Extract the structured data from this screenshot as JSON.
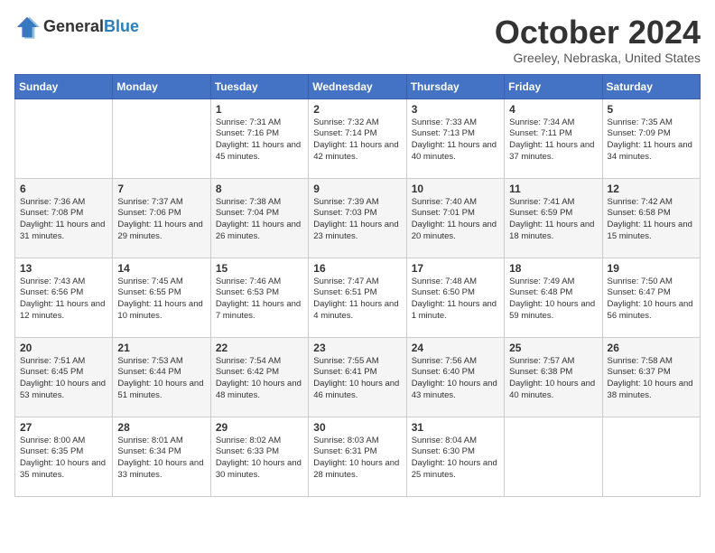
{
  "header": {
    "logo_general": "General",
    "logo_blue": "Blue",
    "month_title": "October 2024",
    "location": "Greeley, Nebraska, United States"
  },
  "days_of_week": [
    "Sunday",
    "Monday",
    "Tuesday",
    "Wednesday",
    "Thursday",
    "Friday",
    "Saturday"
  ],
  "weeks": [
    [
      {
        "day": "",
        "sunrise": "",
        "sunset": "",
        "daylight": ""
      },
      {
        "day": "",
        "sunrise": "",
        "sunset": "",
        "daylight": ""
      },
      {
        "day": "1",
        "sunrise": "Sunrise: 7:31 AM",
        "sunset": "Sunset: 7:16 PM",
        "daylight": "Daylight: 11 hours and 45 minutes."
      },
      {
        "day": "2",
        "sunrise": "Sunrise: 7:32 AM",
        "sunset": "Sunset: 7:14 PM",
        "daylight": "Daylight: 11 hours and 42 minutes."
      },
      {
        "day": "3",
        "sunrise": "Sunrise: 7:33 AM",
        "sunset": "Sunset: 7:13 PM",
        "daylight": "Daylight: 11 hours and 40 minutes."
      },
      {
        "day": "4",
        "sunrise": "Sunrise: 7:34 AM",
        "sunset": "Sunset: 7:11 PM",
        "daylight": "Daylight: 11 hours and 37 minutes."
      },
      {
        "day": "5",
        "sunrise": "Sunrise: 7:35 AM",
        "sunset": "Sunset: 7:09 PM",
        "daylight": "Daylight: 11 hours and 34 minutes."
      }
    ],
    [
      {
        "day": "6",
        "sunrise": "Sunrise: 7:36 AM",
        "sunset": "Sunset: 7:08 PM",
        "daylight": "Daylight: 11 hours and 31 minutes."
      },
      {
        "day": "7",
        "sunrise": "Sunrise: 7:37 AM",
        "sunset": "Sunset: 7:06 PM",
        "daylight": "Daylight: 11 hours and 29 minutes."
      },
      {
        "day": "8",
        "sunrise": "Sunrise: 7:38 AM",
        "sunset": "Sunset: 7:04 PM",
        "daylight": "Daylight: 11 hours and 26 minutes."
      },
      {
        "day": "9",
        "sunrise": "Sunrise: 7:39 AM",
        "sunset": "Sunset: 7:03 PM",
        "daylight": "Daylight: 11 hours and 23 minutes."
      },
      {
        "day": "10",
        "sunrise": "Sunrise: 7:40 AM",
        "sunset": "Sunset: 7:01 PM",
        "daylight": "Daylight: 11 hours and 20 minutes."
      },
      {
        "day": "11",
        "sunrise": "Sunrise: 7:41 AM",
        "sunset": "Sunset: 6:59 PM",
        "daylight": "Daylight: 11 hours and 18 minutes."
      },
      {
        "day": "12",
        "sunrise": "Sunrise: 7:42 AM",
        "sunset": "Sunset: 6:58 PM",
        "daylight": "Daylight: 11 hours and 15 minutes."
      }
    ],
    [
      {
        "day": "13",
        "sunrise": "Sunrise: 7:43 AM",
        "sunset": "Sunset: 6:56 PM",
        "daylight": "Daylight: 11 hours and 12 minutes."
      },
      {
        "day": "14",
        "sunrise": "Sunrise: 7:45 AM",
        "sunset": "Sunset: 6:55 PM",
        "daylight": "Daylight: 11 hours and 10 minutes."
      },
      {
        "day": "15",
        "sunrise": "Sunrise: 7:46 AM",
        "sunset": "Sunset: 6:53 PM",
        "daylight": "Daylight: 11 hours and 7 minutes."
      },
      {
        "day": "16",
        "sunrise": "Sunrise: 7:47 AM",
        "sunset": "Sunset: 6:51 PM",
        "daylight": "Daylight: 11 hours and 4 minutes."
      },
      {
        "day": "17",
        "sunrise": "Sunrise: 7:48 AM",
        "sunset": "Sunset: 6:50 PM",
        "daylight": "Daylight: 11 hours and 1 minute."
      },
      {
        "day": "18",
        "sunrise": "Sunrise: 7:49 AM",
        "sunset": "Sunset: 6:48 PM",
        "daylight": "Daylight: 10 hours and 59 minutes."
      },
      {
        "day": "19",
        "sunrise": "Sunrise: 7:50 AM",
        "sunset": "Sunset: 6:47 PM",
        "daylight": "Daylight: 10 hours and 56 minutes."
      }
    ],
    [
      {
        "day": "20",
        "sunrise": "Sunrise: 7:51 AM",
        "sunset": "Sunset: 6:45 PM",
        "daylight": "Daylight: 10 hours and 53 minutes."
      },
      {
        "day": "21",
        "sunrise": "Sunrise: 7:53 AM",
        "sunset": "Sunset: 6:44 PM",
        "daylight": "Daylight: 10 hours and 51 minutes."
      },
      {
        "day": "22",
        "sunrise": "Sunrise: 7:54 AM",
        "sunset": "Sunset: 6:42 PM",
        "daylight": "Daylight: 10 hours and 48 minutes."
      },
      {
        "day": "23",
        "sunrise": "Sunrise: 7:55 AM",
        "sunset": "Sunset: 6:41 PM",
        "daylight": "Daylight: 10 hours and 46 minutes."
      },
      {
        "day": "24",
        "sunrise": "Sunrise: 7:56 AM",
        "sunset": "Sunset: 6:40 PM",
        "daylight": "Daylight: 10 hours and 43 minutes."
      },
      {
        "day": "25",
        "sunrise": "Sunrise: 7:57 AM",
        "sunset": "Sunset: 6:38 PM",
        "daylight": "Daylight: 10 hours and 40 minutes."
      },
      {
        "day": "26",
        "sunrise": "Sunrise: 7:58 AM",
        "sunset": "Sunset: 6:37 PM",
        "daylight": "Daylight: 10 hours and 38 minutes."
      }
    ],
    [
      {
        "day": "27",
        "sunrise": "Sunrise: 8:00 AM",
        "sunset": "Sunset: 6:35 PM",
        "daylight": "Daylight: 10 hours and 35 minutes."
      },
      {
        "day": "28",
        "sunrise": "Sunrise: 8:01 AM",
        "sunset": "Sunset: 6:34 PM",
        "daylight": "Daylight: 10 hours and 33 minutes."
      },
      {
        "day": "29",
        "sunrise": "Sunrise: 8:02 AM",
        "sunset": "Sunset: 6:33 PM",
        "daylight": "Daylight: 10 hours and 30 minutes."
      },
      {
        "day": "30",
        "sunrise": "Sunrise: 8:03 AM",
        "sunset": "Sunset: 6:31 PM",
        "daylight": "Daylight: 10 hours and 28 minutes."
      },
      {
        "day": "31",
        "sunrise": "Sunrise: 8:04 AM",
        "sunset": "Sunset: 6:30 PM",
        "daylight": "Daylight: 10 hours and 25 minutes."
      },
      {
        "day": "",
        "sunrise": "",
        "sunset": "",
        "daylight": ""
      },
      {
        "day": "",
        "sunrise": "",
        "sunset": "",
        "daylight": ""
      }
    ]
  ]
}
